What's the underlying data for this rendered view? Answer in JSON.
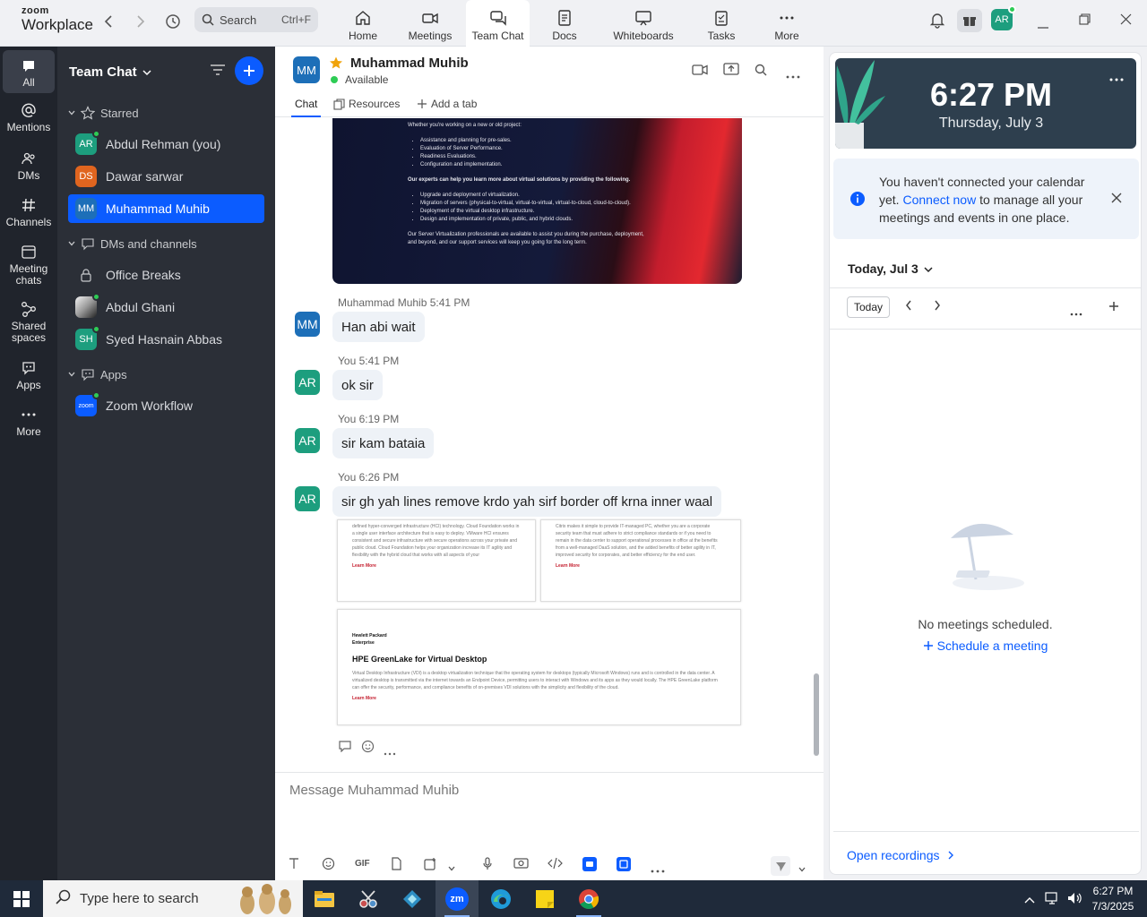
{
  "app": {
    "logo_line1": "zoom",
    "logo_line2": "Workplace",
    "search_label": "Search",
    "search_shortcut": "Ctrl+F"
  },
  "tabs": [
    {
      "label": "Home",
      "icon": "home-icon"
    },
    {
      "label": "Meetings",
      "icon": "video-icon"
    },
    {
      "label": "Team Chat",
      "icon": "chat-icon",
      "active": true
    },
    {
      "label": "Docs",
      "icon": "doc-icon"
    },
    {
      "label": "Whiteboards",
      "icon": "whiteboard-icon"
    },
    {
      "label": "Tasks",
      "icon": "tasks-icon"
    },
    {
      "label": "More",
      "icon": "more-icon"
    }
  ],
  "user": {
    "initials": "AR"
  },
  "rail": [
    {
      "label": "All",
      "icon": "chat-bubble-icon",
      "active": true
    },
    {
      "label": "Mentions",
      "icon": "at-icon"
    },
    {
      "label": "DMs",
      "icon": "people-icon"
    },
    {
      "label": "Channels",
      "icon": "hash-icon"
    },
    {
      "label": "Meeting chats",
      "icon": "calendar-icon"
    },
    {
      "label": "Shared spaces",
      "icon": "shared-icon"
    },
    {
      "label": "Apps",
      "icon": "apps-icon"
    },
    {
      "label": "More",
      "icon": "more-icon"
    }
  ],
  "sidebar": {
    "title": "Team Chat",
    "sections": {
      "starred": "Starred",
      "dms": "DMs and channels",
      "apps": "Apps"
    },
    "starred": [
      {
        "initials": "AR",
        "name": "Abdul Rehman (you)",
        "color": "#1d9e7e",
        "online": true
      },
      {
        "initials": "DS",
        "name": "Dawar sarwar",
        "color": "#e0651f",
        "online": false
      },
      {
        "initials": "MM",
        "name": "Muhammad Muhib",
        "color": "#1d6fb8",
        "online": false,
        "active": true
      }
    ],
    "dms": [
      {
        "initials": "",
        "name": "Office Breaks",
        "icon": "lock-icon"
      },
      {
        "initials": "",
        "name": "Abdul Ghani",
        "color": "#555",
        "online": true
      },
      {
        "initials": "SH",
        "name": "Syed Hasnain Abbas",
        "color": "#1d9e7e",
        "online": true
      }
    ],
    "apps": [
      {
        "initials": "zoom",
        "name": "Zoom Workflow",
        "color": "#0b5cff",
        "online": true
      }
    ]
  },
  "chat": {
    "contact_initials": "MM",
    "contact_name": "Muhammad Muhib",
    "status": "Available",
    "tabs": {
      "chat": "Chat",
      "resources": "Resources",
      "add": "Add a tab"
    },
    "image_text": {
      "intro": "Whether you're working on a new or old project:",
      "list1": [
        "Assistance and planning for pre-sales.",
        "Evaluation of Server Performance.",
        "Readiness Evaluations.",
        "Configuration and implementation."
      ],
      "middle": "Our experts can help you learn more about virtual solutions by providing the following.",
      "list2": [
        "Upgrade and deployment of virtualization.",
        "Migration of servers (physical-to-virtual, virtual-to-virtual, virtual-to-cloud, cloud-to-cloud).",
        "Deployment of the virtual desktop infrastructure.",
        "Design and implementation of private, public, and hybrid clouds."
      ],
      "outro": "Our Server Virtualization professionals are available to assist you during the purchase, deployment, and beyond, and our support services will keep you going for the long term."
    },
    "messages": [
      {
        "sender": "Muhammad Muhib",
        "time": "5:41 PM",
        "initials": "MM",
        "color": "#1d6fb8",
        "text": "Han abi wait"
      },
      {
        "sender": "You",
        "time": "5:41 PM",
        "initials": "AR",
        "color": "#1d9e7e",
        "text": "ok sir"
      },
      {
        "sender": "You",
        "time": "6:19 PM",
        "initials": "AR",
        "color": "#1d9e7e",
        "text": "sir kam bataia"
      },
      {
        "sender": "You",
        "time": "6:26 PM",
        "initials": "AR",
        "color": "#1d9e7e",
        "text": "sir gh yah lines remove krdo yah sirf border off krna inner waal"
      }
    ],
    "cards": {
      "card1": "defined hyper-converged infrastructure (HCI) technology. Cloud Foundation works in a single user interface architecture that is easy to deploy. VMware HCI ensures consistent and secure infrastructure with secure operations across your private and public cloud. Cloud Foundation helps your organization increase its IT agility and flexibility with the hybrid cloud that works with all aspects of your",
      "card2": "Citrix makes it simple to provide IT-managed PC, whether you are a corporate security team that must adhere to strict compliance standards or if you need to remain in the data center to support operational processes in office at the benefits from a well-managed DaaS solution, and the added benefits of better agility in IT, improved security for corporates, and better efficiency for the end user.",
      "learn_more": "Learn More",
      "hpe_brand": "Hewlett Packard Enterprise",
      "hpe_title": "HPE GreenLake for Virtual Desktop",
      "card3": "Virtual Desktop Infrastructure (VDI) is a desktop virtualization technique that the operating system for desktops (typically Microsoft Windows) runs and is controlled in the data center. A virtualized desktop is transmitted via the internet towards an Endpoint Device, permitting users to interact with Windows and its apps as they would locally. The HPE GreenLake platform can offer the security, performance, and compliance benefits of on-premises VDI solutions with the simplicity and flexibility of the cloud."
    },
    "composer_placeholder": "Message Muhammad Muhib",
    "gif_label": "GIF"
  },
  "right": {
    "time": "6:27 PM",
    "date": "Thursday, July 3",
    "notice_a": "You haven't connected your calendar yet. ",
    "notice_link": "Connect now",
    "notice_b": " to manage all your meetings and events in one place.",
    "today_label": "Today, Jul 3",
    "today_btn": "Today",
    "empty": "No meetings scheduled.",
    "schedule": "Schedule a meeting",
    "recordings": "Open recordings"
  },
  "taskbar": {
    "search": "Type here to search",
    "time": "6:27 PM",
    "date": "7/3/2025",
    "zoom_app": "zm"
  }
}
